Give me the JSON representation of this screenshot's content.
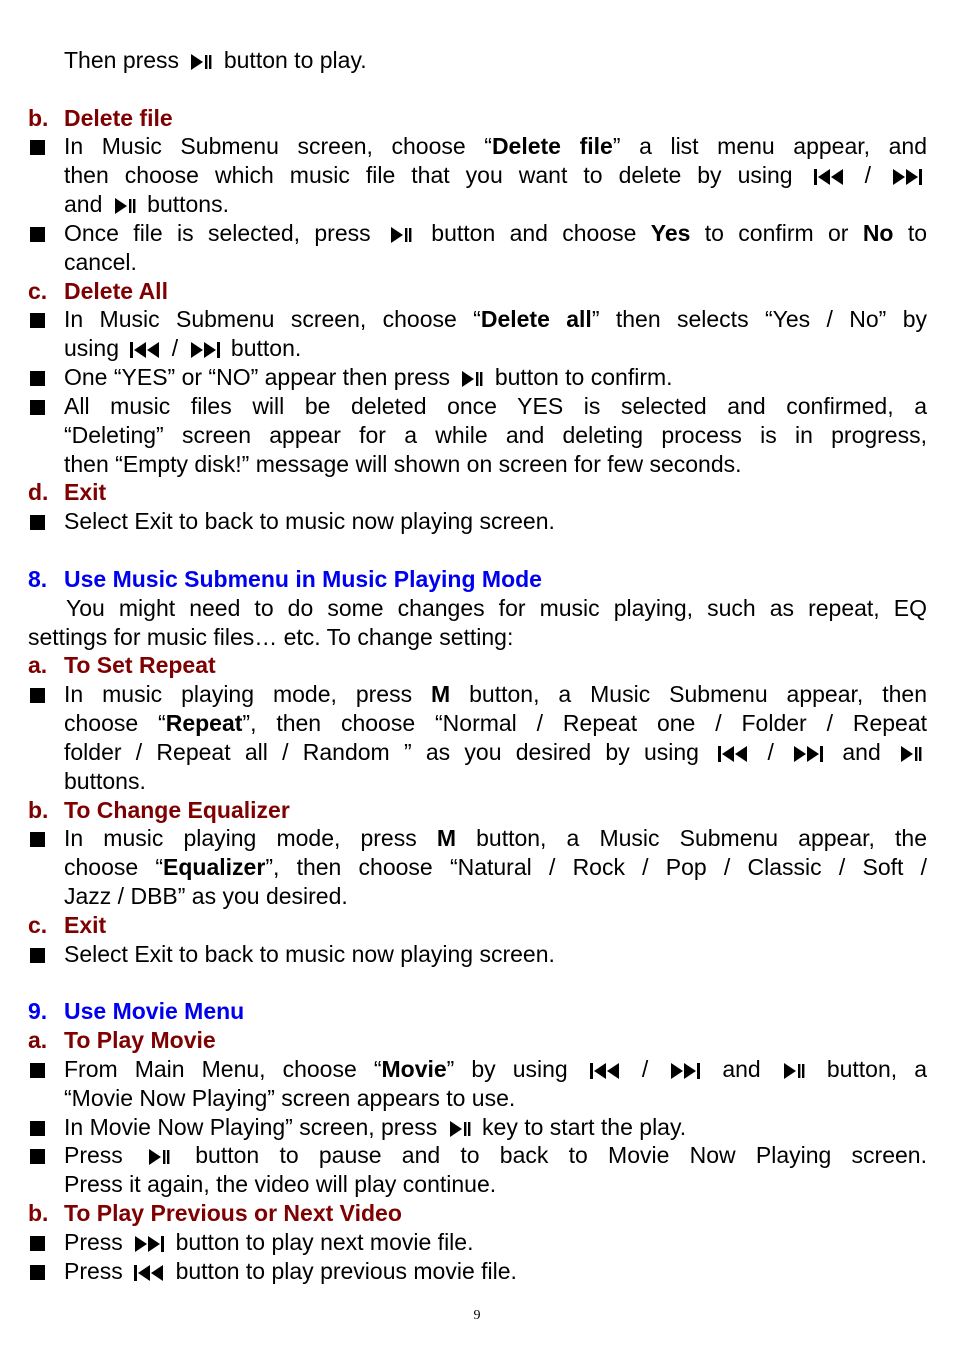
{
  "colors": {
    "subheading": "#7f0000",
    "section_heading": "#0000f0",
    "text": "#000000"
  },
  "lines": [
    {
      "k": "cont",
      "x": 64,
      "segs": [
        {
          "t": "Then press "
        },
        {
          "i": "play-pause"
        },
        {
          "t": " button to play."
        }
      ]
    },
    {
      "k": "blank"
    },
    {
      "k": "h-red",
      "label": "b.",
      "segs": [
        {
          "t": "Delete file"
        }
      ]
    },
    {
      "k": "bullet",
      "j": true,
      "segs": [
        {
          "t": "In Music Submenu screen, choose “"
        },
        {
          "b": "Delete file"
        },
        {
          "t": "” a list menu appear, and"
        }
      ]
    },
    {
      "k": "cont",
      "j": true,
      "segs": [
        {
          "t": "then choose which music file that you want to delete by using "
        },
        {
          "i": "previous"
        },
        {
          "t": " / "
        },
        {
          "i": "next"
        }
      ]
    },
    {
      "k": "cont",
      "segs": [
        {
          "t": "and "
        },
        {
          "i": "play-pause"
        },
        {
          "t": " buttons."
        }
      ]
    },
    {
      "k": "bullet",
      "j": true,
      "segs": [
        {
          "t": "Once file is selected, press "
        },
        {
          "i": "play-pause"
        },
        {
          "t": " button and choose "
        },
        {
          "b": "Yes"
        },
        {
          "t": " to confirm or "
        },
        {
          "b": "No"
        },
        {
          "t": " to"
        }
      ]
    },
    {
      "k": "cont",
      "segs": [
        {
          "t": "cancel."
        }
      ]
    },
    {
      "k": "h-red",
      "label": "c.",
      "segs": [
        {
          "t": "Delete All"
        }
      ]
    },
    {
      "k": "bullet",
      "j": true,
      "segs": [
        {
          "t": "In Music Submenu screen, choose “"
        },
        {
          "b": "Delete all"
        },
        {
          "t": "” then selects “Yes / No” by"
        }
      ]
    },
    {
      "k": "cont",
      "segs": [
        {
          "t": "using "
        },
        {
          "i": "previous"
        },
        {
          "t": " / "
        },
        {
          "i": "next"
        },
        {
          "t": " button."
        }
      ]
    },
    {
      "k": "bullet",
      "segs": [
        {
          "t": "One “YES” or “NO” appear then press "
        },
        {
          "i": "play-pause"
        },
        {
          "t": " button to confirm."
        }
      ]
    },
    {
      "k": "bullet",
      "j": true,
      "segs": [
        {
          "t": "All music files will be deleted once YES is selected and confirmed, a"
        }
      ]
    },
    {
      "k": "cont",
      "j": true,
      "segs": [
        {
          "t": "“Deleting” screen appear for a while and deleting process is in progress,"
        }
      ]
    },
    {
      "k": "cont",
      "segs": [
        {
          "t": "then “Empty disk!” message will shown on screen for few seconds."
        }
      ]
    },
    {
      "k": "h-red",
      "label": "d.",
      "segs": [
        {
          "t": "Exit"
        }
      ]
    },
    {
      "k": "bullet",
      "segs": [
        {
          "t": "Select Exit to back to music now playing screen."
        }
      ]
    },
    {
      "k": "blank"
    },
    {
      "k": "h-blue",
      "label": "8.",
      "segs": [
        {
          "t": "Use Music Submenu in Music Playing Mode"
        }
      ]
    },
    {
      "k": "cont",
      "x": 66,
      "j": true,
      "segs": [
        {
          "t": "You might need to do some changes for music playing, such as repeat, EQ"
        }
      ]
    },
    {
      "k": "cont",
      "x": 28,
      "segs": [
        {
          "t": "settings for music files… etc. To change setting:"
        }
      ]
    },
    {
      "k": "h-red",
      "label": "a.",
      "segs": [
        {
          "t": "To Set Repeat"
        }
      ]
    },
    {
      "k": "bullet",
      "j": true,
      "segs": [
        {
          "t": "In music playing mode, press "
        },
        {
          "b": "M"
        },
        {
          "t": " button, a Music Submenu appear, then"
        }
      ]
    },
    {
      "k": "cont",
      "j": true,
      "segs": [
        {
          "t": "choose “"
        },
        {
          "b": "Repeat"
        },
        {
          "t": "”, then choose “Normal / Repeat one / Folder / Repeat"
        }
      ]
    },
    {
      "k": "cont",
      "j": true,
      "segs": [
        {
          "t": "folder / Repeat all / Random ” as you desired by using "
        },
        {
          "i": "previous"
        },
        {
          "t": " / "
        },
        {
          "i": "next"
        },
        {
          "t": " and "
        },
        {
          "i": "play-pause"
        }
      ]
    },
    {
      "k": "cont",
      "segs": [
        {
          "t": "buttons."
        }
      ]
    },
    {
      "k": "h-red",
      "label": "b.",
      "segs": [
        {
          "t": "To Change Equalizer"
        }
      ]
    },
    {
      "k": "bullet",
      "j": true,
      "segs": [
        {
          "t": "In music playing mode, press "
        },
        {
          "b": "M"
        },
        {
          "t": " button, a Music Submenu appear, the"
        }
      ]
    },
    {
      "k": "cont",
      "j": true,
      "segs": [
        {
          "t": "choose “"
        },
        {
          "b": "Equalizer"
        },
        {
          "t": "”, then choose “Natural / Rock / Pop / Classic / Soft /"
        }
      ]
    },
    {
      "k": "cont",
      "segs": [
        {
          "t": "Jazz / DBB” as you desired."
        }
      ]
    },
    {
      "k": "h-red",
      "label": "c.",
      "segs": [
        {
          "t": "Exit"
        }
      ]
    },
    {
      "k": "bullet",
      "segs": [
        {
          "t": "Select Exit to back to music now playing screen."
        }
      ]
    },
    {
      "k": "blank"
    },
    {
      "k": "h-blue",
      "label": "9.",
      "segs": [
        {
          "t": "Use Movie Menu"
        }
      ]
    },
    {
      "k": "h-red",
      "label": "a.",
      "segs": [
        {
          "t": "To Play Movie"
        }
      ]
    },
    {
      "k": "bullet",
      "j": true,
      "segs": [
        {
          "t": "From Main Menu, choose “"
        },
        {
          "b": "Movie"
        },
        {
          "t": "” by using "
        },
        {
          "i": "previous"
        },
        {
          "t": " / "
        },
        {
          "i": "next"
        },
        {
          "t": " and "
        },
        {
          "i": "play-pause"
        },
        {
          "t": " button, a"
        }
      ]
    },
    {
      "k": "cont",
      "segs": [
        {
          "t": "“Movie Now Playing” screen appears to use."
        }
      ]
    },
    {
      "k": "bullet",
      "segs": [
        {
          "t": "In Movie Now Playing” screen, press "
        },
        {
          "i": "play-pause"
        },
        {
          "t": " key to start the play."
        }
      ]
    },
    {
      "k": "bullet",
      "j": true,
      "segs": [
        {
          "t": "Press "
        },
        {
          "i": "play-pause"
        },
        {
          "t": " button to pause and to back to Movie Now Playing screen."
        }
      ]
    },
    {
      "k": "cont",
      "segs": [
        {
          "t": "Press it again, the video will play continue."
        }
      ]
    },
    {
      "k": "h-red",
      "label": "b.",
      "segs": [
        {
          "t": "To Play Previous or Next Video"
        }
      ]
    },
    {
      "k": "bullet",
      "segs": [
        {
          "t": "Press "
        },
        {
          "i": "next"
        },
        {
          "t": " button to play next movie file."
        }
      ]
    },
    {
      "k": "bullet",
      "segs": [
        {
          "t": "Press "
        },
        {
          "i": "previous"
        },
        {
          "t": " button to play previous movie file."
        }
      ]
    }
  ],
  "page_number": "9"
}
